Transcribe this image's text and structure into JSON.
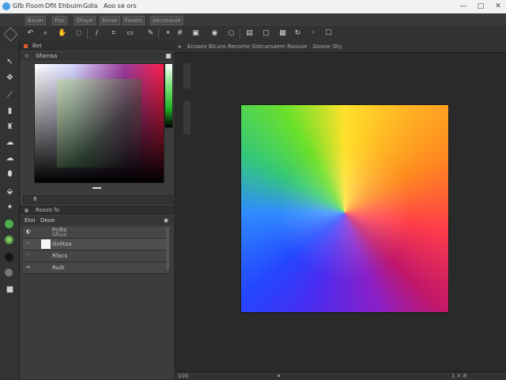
{
  "window": {
    "title_parts": [
      "Gfb Fisom",
      "Dfit Ehbuim",
      "Gdia",
      "Aoo se ors"
    ],
    "controls": [
      "—",
      "□",
      "✕"
    ]
  },
  "menu": {
    "items": [
      "Bacer",
      "Fizs",
      "Dfaye",
      "Esrae",
      "Fiewts",
      "Aecosauie"
    ]
  },
  "options_bar": {
    "icons": [
      "undo-icon",
      "zoom-icon",
      "hand-icon",
      "lasso-icon",
      "brush-icon",
      "crop-icon",
      "eraser-icon",
      "eyedropper-icon",
      "transform-icon",
      "grid-icon",
      "camera-icon",
      "circle-icon",
      "layers-icon",
      "frame-icon",
      "picture-icon",
      "ring-icon",
      "dot-icon",
      "square-icon"
    ]
  },
  "toolbox": {
    "icons": [
      "move-icon",
      "select-icon",
      "lasso-icon",
      "brush-icon",
      "stamp-icon",
      "smudge-icon",
      "eraser-icon",
      "bucket-icon",
      "pen-icon",
      "color-dot-icon",
      "gradient-icon",
      "shape-icon",
      "ellipse-icon",
      "hand-icon"
    ]
  },
  "color_panel": {
    "header": "Bet",
    "tab": "Gfarnsa",
    "foot_label": "8"
  },
  "layers_panel": {
    "header": "Roeze fo",
    "column_left": "Etoi",
    "column_right": "Deoe",
    "rows": [
      {
        "name": "Fcilts",
        "sub": "Gfluut"
      },
      {
        "name": "Gniltsa",
        "sub": ""
      },
      {
        "name": "Rfacs",
        "sub": ""
      },
      {
        "name": "Ruilt",
        "sub": ""
      }
    ]
  },
  "document": {
    "tab_text": "Ecoxex  Blcuro Recome  Gotcarsaem Roouse · Goane Gty",
    "status_left": "100",
    "status_right": "1 ✕ 8"
  },
  "colors": {
    "titlebar_bg": "#f2f2f2",
    "app_bg": "#2b2b2b",
    "panel_bg": "#3c3c3c",
    "accent": "#4a9be8"
  }
}
